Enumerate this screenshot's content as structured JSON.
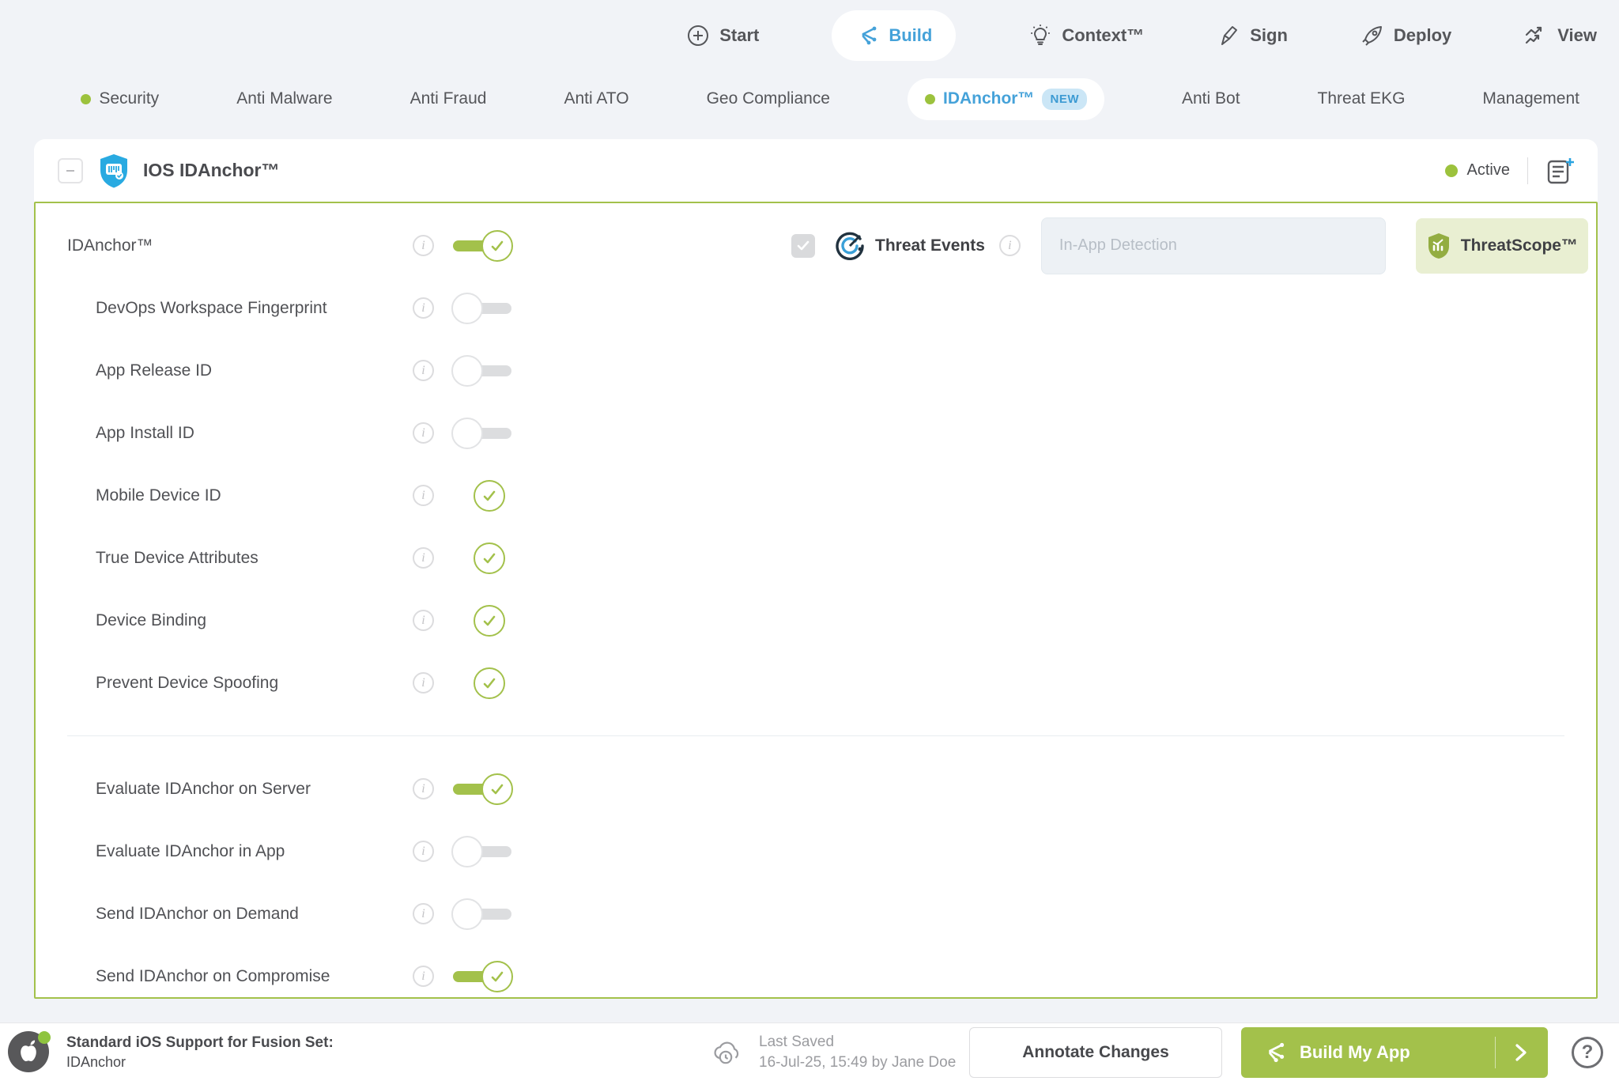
{
  "colors": {
    "accent_green": "#a3c14b",
    "accent_blue": "#45a2d9",
    "status_dot_green": "#9cc23d",
    "page_bg": "#f1f3f7"
  },
  "top_nav": {
    "items": [
      {
        "label": "Start",
        "icon": "plus-circle-icon",
        "active": false
      },
      {
        "label": "Build",
        "icon": "fusion-icon",
        "active": true
      },
      {
        "label": "Context™",
        "icon": "lightbulb-icon",
        "active": false
      },
      {
        "label": "Sign",
        "icon": "pen-icon",
        "active": false
      },
      {
        "label": "Deploy",
        "icon": "rocket-icon",
        "active": false
      },
      {
        "label": "View",
        "icon": "pulse-icon",
        "active": false
      }
    ]
  },
  "sub_nav": {
    "items": [
      {
        "label": "Security",
        "dot": true,
        "active": false
      },
      {
        "label": "Anti Malware",
        "dot": false,
        "active": false
      },
      {
        "label": "Anti Fraud",
        "dot": false,
        "active": false
      },
      {
        "label": "Anti ATO",
        "dot": false,
        "active": false
      },
      {
        "label": "Geo Compliance",
        "dot": false,
        "active": false
      },
      {
        "label": "IDAnchor™",
        "dot": true,
        "active": true,
        "badge": "NEW"
      },
      {
        "label": "Anti Bot",
        "dot": false,
        "active": false
      },
      {
        "label": "Threat EKG",
        "dot": false,
        "active": false
      },
      {
        "label": "Management",
        "dot": false,
        "active": false
      }
    ]
  },
  "panel": {
    "title": "IOS IDAnchor™",
    "status": "Active",
    "feature": {
      "label": "IDAnchor™",
      "state": "on"
    },
    "threat_events": {
      "checkbox_checked": true,
      "label": "Threat Events",
      "input_placeholder": "In-App Detection",
      "button_label": "ThreatScope™"
    },
    "toggles": [
      {
        "label": "DevOps Workspace Fingerprint",
        "state": "off"
      },
      {
        "label": "App Release ID",
        "state": "off"
      },
      {
        "label": "App Install ID",
        "state": "off"
      },
      {
        "label": "Mobile Device ID",
        "state": "check"
      },
      {
        "label": "True Device Attributes",
        "state": "check"
      },
      {
        "label": "Device Binding",
        "state": "check"
      },
      {
        "label": "Prevent Device Spoofing",
        "state": "check"
      }
    ],
    "evaluation_toggles": [
      {
        "label": "Evaluate IDAnchor on Server",
        "state": "on"
      },
      {
        "label": "Evaluate IDAnchor in App",
        "state": "off"
      },
      {
        "label": "Send IDAnchor on Demand",
        "state": "off"
      },
      {
        "label": "Send IDAnchor on Compromise",
        "state": "on"
      }
    ]
  },
  "footer": {
    "fusion_title": "Standard iOS Support for Fusion Set:",
    "fusion_name": "IDAnchor",
    "last_saved_label": "Last Saved",
    "last_saved_detail": "16-Jul-25, 15:49 by Jane Doe",
    "annotate_button": "Annotate Changes",
    "build_button": "Build My App"
  }
}
